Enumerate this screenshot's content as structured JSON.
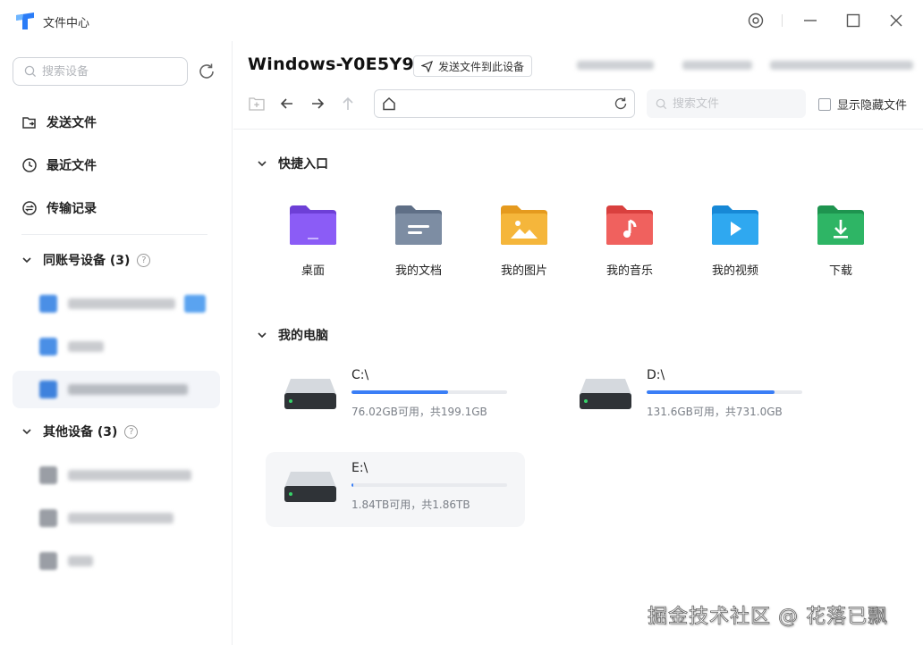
{
  "app": {
    "title": "文件中心"
  },
  "sidebar": {
    "search_placeholder": "搜索设备",
    "nav": [
      {
        "label": "发送文件",
        "icon": "send-file-icon"
      },
      {
        "label": "最近文件",
        "icon": "clock-icon"
      },
      {
        "label": "传输记录",
        "icon": "transfer-icon"
      }
    ],
    "groups": [
      {
        "label": "同账号设备 (3)",
        "help": "?"
      },
      {
        "label": "其他设备 (3)",
        "help": "?"
      }
    ]
  },
  "main": {
    "device_name": "Windows-Y0E5Y9",
    "send_button": "发送文件到此设备",
    "path_value": "",
    "search_placeholder": "搜索文件",
    "show_hidden_label": "显示隐藏文件",
    "sections": {
      "quick": "快捷入口",
      "computer": "我的电脑"
    },
    "quick_items": [
      {
        "label": "桌面",
        "color": "#8b5cf6",
        "icon": "desktop-folder-icon"
      },
      {
        "label": "我的文档",
        "color": "#7d8da3",
        "icon": "documents-folder-icon"
      },
      {
        "label": "我的图片",
        "color": "#f5b63b",
        "icon": "pictures-folder-icon"
      },
      {
        "label": "我的音乐",
        "color": "#f0615e",
        "icon": "music-folder-icon"
      },
      {
        "label": "我的视频",
        "color": "#2fa8f0",
        "icon": "videos-folder-icon"
      },
      {
        "label": "下载",
        "color": "#2eb565",
        "icon": "downloads-folder-icon"
      }
    ],
    "drives": [
      {
        "name": "C:\\",
        "info": "76.02GB可用，共199.1GB",
        "used_fraction": 0.62
      },
      {
        "name": "D:\\",
        "info": "131.6GB可用，共731.0GB",
        "used_fraction": 0.82
      },
      {
        "name": "E:\\",
        "info": "1.84TB可用，共1.86TB",
        "used_fraction": 0.01
      }
    ]
  },
  "watermark": "掘金技术社区 @ 花落已飘",
  "colors": {
    "accent": "#3a7ef6",
    "logo": "#2a7cf7"
  }
}
